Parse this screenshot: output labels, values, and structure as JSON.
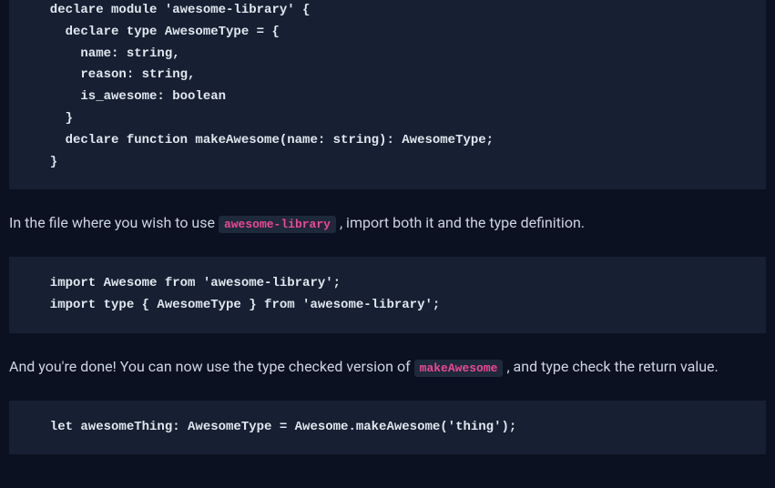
{
  "codeBlock1": "  declare module 'awesome-library' {\n    declare type AwesomeType = {\n      name: string,\n      reason: string,\n      is_awesome: boolean\n    }\n    declare function makeAwesome(name: string): AwesomeType;\n  }",
  "prose1_before": "In the file where you wish to use ",
  "prose1_code": "awesome-library",
  "prose1_after": " , import both it and the type definition.",
  "codeBlock2": "  import Awesome from 'awesome-library';\n  import type { AwesomeType } from 'awesome-library';",
  "prose2_before": "And you're done! You can now use the type checked version of ",
  "prose2_code": "makeAwesome",
  "prose2_after": " , and type check the return value.",
  "codeBlock3": "  let awesomeThing: AwesomeType = Awesome.makeAwesome('thing');"
}
